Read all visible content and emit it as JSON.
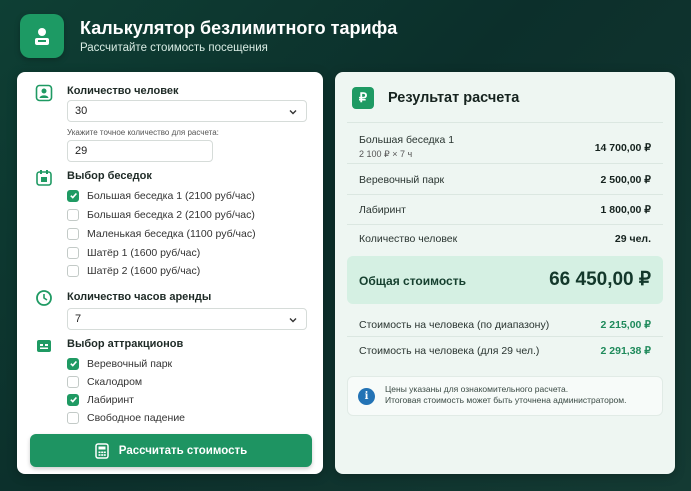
{
  "header": {
    "title": "Калькулятор безлимитного тарифа",
    "subtitle": "Рассчитайте стоимость посещения"
  },
  "form": {
    "people": {
      "label": "Количество человек",
      "selected": "30",
      "hint": "Укажите точное количество для расчета:",
      "exact_value": "29"
    },
    "gazebos": {
      "label": "Выбор беседок",
      "options": [
        {
          "label": "Большая беседка 1 (2100 руб/час)",
          "checked": true
        },
        {
          "label": "Большая беседка 2 (2100 руб/час)",
          "checked": false
        },
        {
          "label": "Маленькая беседка (1100 руб/час)",
          "checked": false
        },
        {
          "label": "Шатёр 1 (1600 руб/час)",
          "checked": false
        },
        {
          "label": "Шатёр 2 (1600 руб/час)",
          "checked": false
        }
      ]
    },
    "hours": {
      "label": "Количество часов аренды",
      "selected": "7"
    },
    "attractions": {
      "label": "Выбор аттракционов",
      "options": [
        {
          "label": "Веревочный парк",
          "checked": true
        },
        {
          "label": "Скалодром",
          "checked": false
        },
        {
          "label": "Лабиринт",
          "checked": true
        },
        {
          "label": "Свободное падение",
          "checked": false
        }
      ]
    },
    "calculate_label": "Рассчитать стоимость"
  },
  "result": {
    "icon_symbol": "₽",
    "title": "Результат расчета",
    "rows": [
      {
        "label": "Большая беседка 1",
        "sub": "2 100 ₽ × 7 ч",
        "value": "14 700,00 ₽"
      },
      {
        "label": "Веревочный парк",
        "value": "2 500,00 ₽"
      },
      {
        "label": "Лабиринт",
        "value": "1 800,00 ₽"
      },
      {
        "label": "Количество человек",
        "value": "29 чел."
      }
    ],
    "total_label": "Общая стоимость",
    "total_value": "66 450,00 ₽",
    "per_person": [
      {
        "label": "Стоимость на человека (по диапазону)",
        "value": "2 215,00 ₽"
      },
      {
        "label": "Стоимость на человека (для 29 чел.)",
        "value": "2 291,38 ₽"
      }
    ],
    "info_icon": "i",
    "info_line1": "Цены указаны для ознакомительного расчета.",
    "info_line2": "Итоговая стоимость может быть уточнена администратором."
  },
  "colors": {
    "accent": "#1e9462",
    "background": "#0e3f34",
    "per_person_value": "#1f8a5b",
    "info": "#2373b5"
  }
}
